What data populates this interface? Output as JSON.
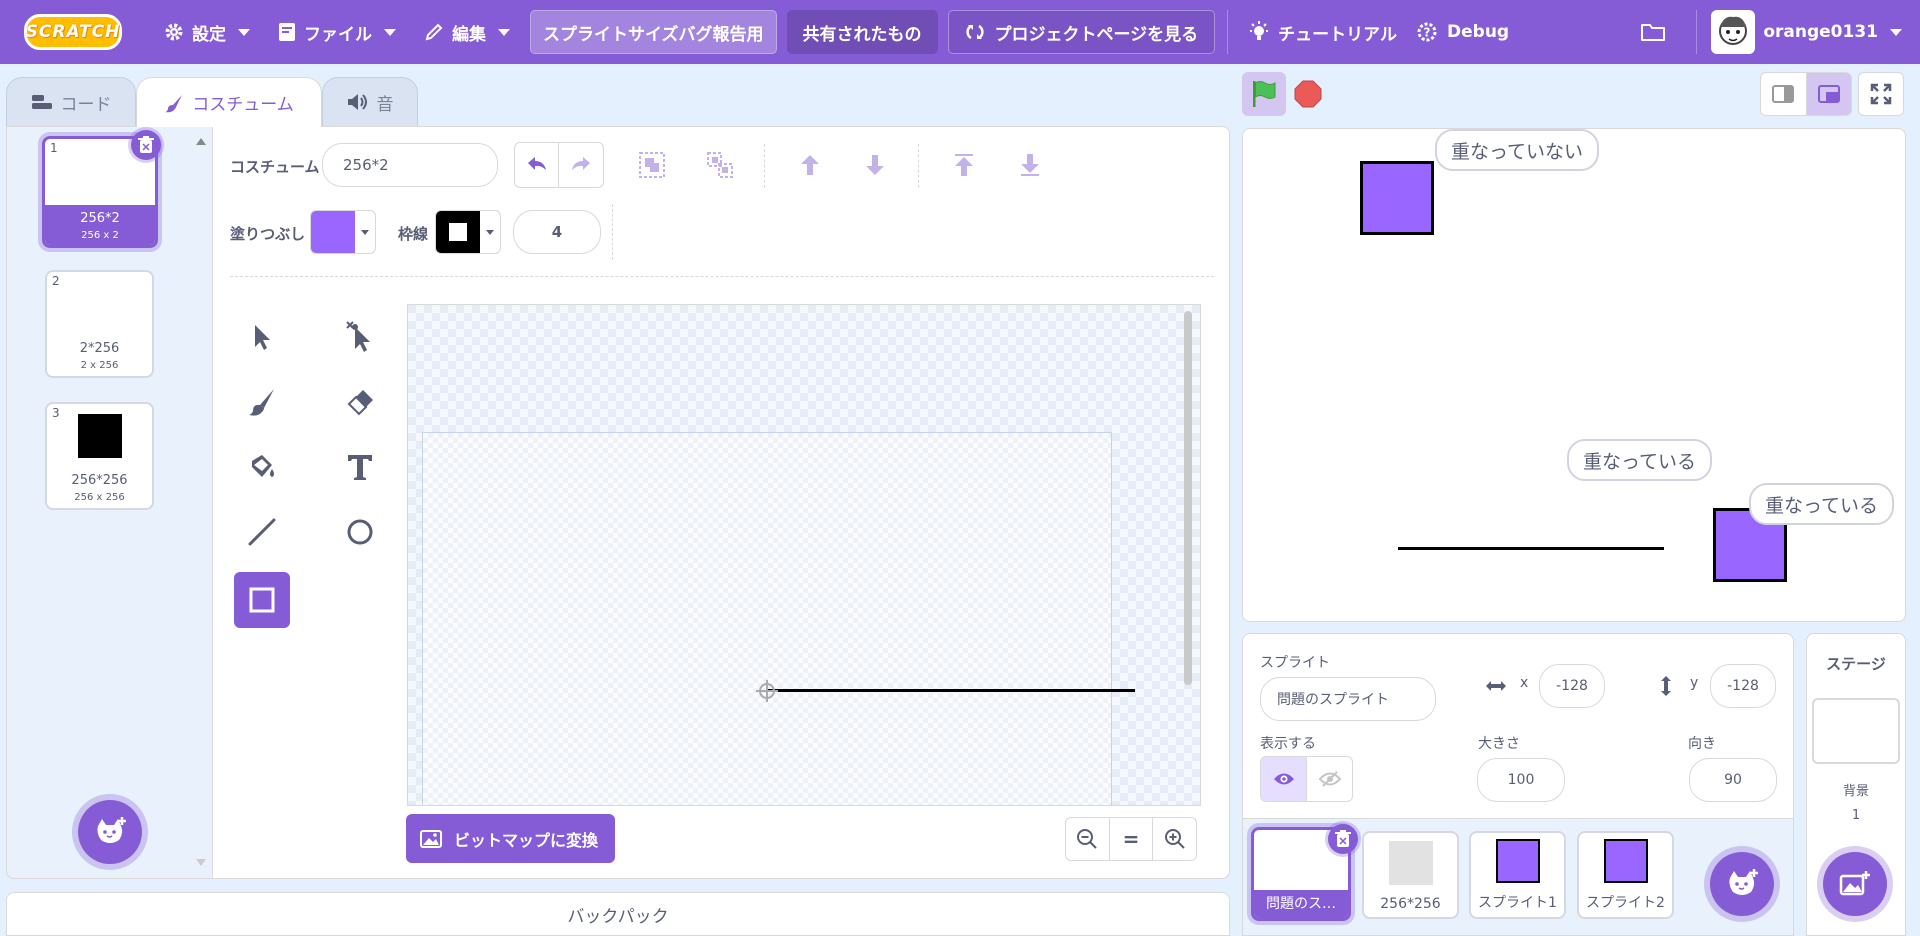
{
  "menubar": {
    "logo": "SCRATCH",
    "settings": "設定",
    "file": "ファイル",
    "edit": "編集",
    "project_title": "スプライトサイズバグ報告用",
    "shared": "共有されたもの",
    "project_page": "プロジェクトページを見る",
    "tutorials": "チュートリアル",
    "debug": "Debug",
    "username": "orange0131"
  },
  "tabs": {
    "code": "コード",
    "costumes": "コスチューム",
    "sounds": "音"
  },
  "costumes": [
    {
      "num": "1",
      "name": "256*2",
      "dims": "256 x 2"
    },
    {
      "num": "2",
      "name": "2*256",
      "dims": "2 x 256"
    },
    {
      "num": "3",
      "name": "256*256",
      "dims": "256 x 256"
    }
  ],
  "paint": {
    "costume_label": "コスチューム",
    "costume_name": "256*2",
    "fill_label": "塗りつぶし",
    "fill_color": "#9966ff",
    "outline_label": "枠線",
    "outline_color": "#000000",
    "outline_width": "4",
    "convert_button": "ビットマップに変換",
    "zoom_reset": "="
  },
  "stage": {
    "bubbles": [
      "重なっていない",
      "重なっている",
      "重なっている"
    ]
  },
  "sprite_info": {
    "sprite_label": "スプライト",
    "sprite_name": "問題のスプライト",
    "x_label": "x",
    "x_value": "-128",
    "y_label": "y",
    "y_value": "-128",
    "show_label": "表示する",
    "size_label": "大きさ",
    "size_value": "100",
    "direction_label": "向き",
    "direction_value": "90"
  },
  "sprites": [
    {
      "name": "問題のス…"
    },
    {
      "name": "256*256"
    },
    {
      "name": "スプライト1"
    },
    {
      "name": "スプライト2"
    }
  ],
  "stage_panel": {
    "title": "ステージ",
    "backdrop_label": "背景",
    "backdrop_count": "1"
  },
  "backpack": "バックパック",
  "colors": {
    "accent": "#855cd6",
    "sprite_purple": "#9966ff",
    "flag_green": "#4cbf56",
    "stop_red": "#ec5959"
  }
}
